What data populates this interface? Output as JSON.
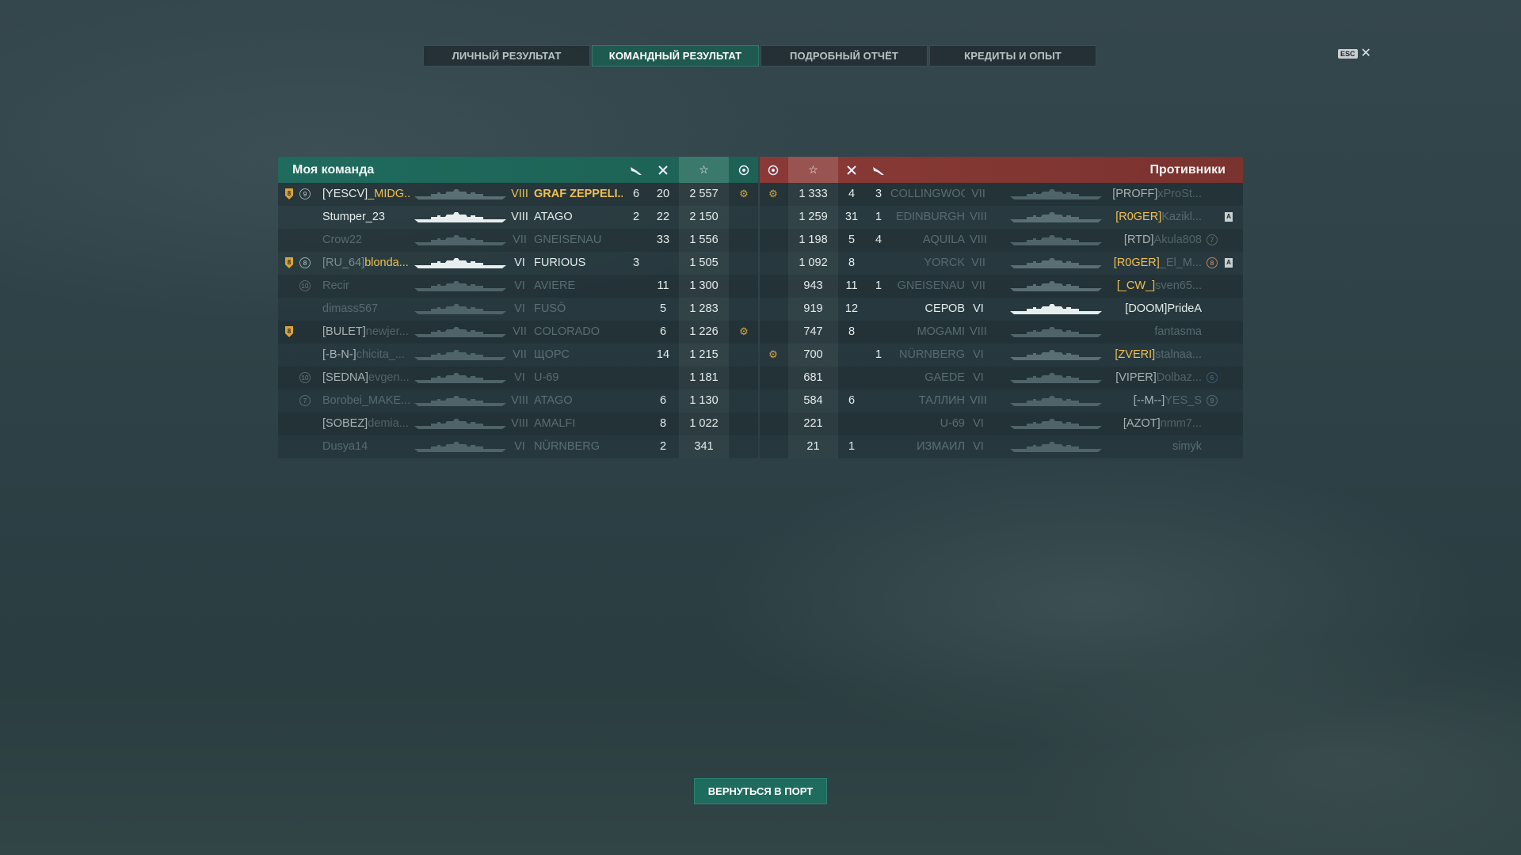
{
  "tabs": [
    "ЛИЧНЫЙ РЕЗУЛЬТАТ",
    "КОМАНДНЫЙ РЕЗУЛЬТАТ",
    "ПОДРОБНЫЙ ОТЧЁТ",
    "КРЕДИТЫ И ОПЫТ"
  ],
  "active_tab": 1,
  "esc": {
    "key": "ESC",
    "close": "✕"
  },
  "my_team": {
    "title": "Моя команда",
    "header_icons": [
      "plane-icon",
      "crossed-swords-icon",
      "star-icon",
      "laurel-icon"
    ],
    "rows": [
      {
        "shield": "8",
        "badge": "9",
        "clan": "[YESCV]",
        "player": "_MIDG...",
        "tier": "VIII",
        "ship": "GRAF ZEPPELI...",
        "planes": "6",
        "kills": "20",
        "xp": "2 557",
        "medal": true,
        "style": "gold",
        "ship_style": "dark"
      },
      {
        "shield": "",
        "badge": "",
        "clan": "",
        "player": "Stumper_23",
        "tier": "VIII",
        "ship": "ATAGO",
        "planes": "2",
        "kills": "22",
        "xp": "2 150",
        "medal": false,
        "style": "normal",
        "ship_style": "light"
      },
      {
        "shield": "",
        "badge": "",
        "clan": "",
        "player": "Crow22",
        "tier": "VII",
        "ship": "GNEISENAU",
        "planes": "",
        "kills": "33",
        "xp": "1 556",
        "medal": false,
        "style": "dim",
        "ship_style": "dark"
      },
      {
        "shield": "8",
        "badge": "8",
        "clan": "[RU_64]",
        "player": "blonda...",
        "tier": "VI",
        "ship": "FURIOUS",
        "planes": "3",
        "kills": "",
        "xp": "1 505",
        "medal": false,
        "style": "gold-name",
        "ship_style": "light"
      },
      {
        "shield": "",
        "badge": "10",
        "clan": "",
        "player": "Recir",
        "tier": "VI",
        "ship": "AVIERE",
        "planes": "",
        "kills": "11",
        "xp": "1 300",
        "medal": false,
        "style": "dim",
        "ship_style": "dark"
      },
      {
        "shield": "",
        "badge": "",
        "clan": "",
        "player": "dimass567",
        "tier": "VI",
        "ship": "FUSŌ",
        "planes": "",
        "kills": "5",
        "xp": "1 283",
        "medal": false,
        "style": "dim",
        "ship_style": "dark"
      },
      {
        "shield": "8",
        "badge": "",
        "clan": "[BULET]",
        "player": "newjer...",
        "tier": "VII",
        "ship": "COLORADO",
        "planes": "",
        "kills": "6",
        "xp": "1 226",
        "medal": true,
        "style": "dim-name",
        "ship_style": "dark"
      },
      {
        "shield": "",
        "badge": "",
        "clan": "[-B-N-]",
        "player": "chicita_...",
        "tier": "VII",
        "ship": "ЩОРС",
        "planes": "",
        "kills": "14",
        "xp": "1 215",
        "medal": false,
        "style": "dim-name",
        "ship_style": "dark"
      },
      {
        "shield": "",
        "badge": "10",
        "clan": "[SEDNA]",
        "player": "evgen...",
        "tier": "VI",
        "ship": "U-69",
        "planes": "",
        "kills": "",
        "xp": "1 181",
        "medal": false,
        "style": "dim-name",
        "ship_style": "dark"
      },
      {
        "shield": "",
        "badge": "7",
        "clan": "",
        "player": "Borobei_MAKE...",
        "tier": "VIII",
        "ship": "ATAGO",
        "planes": "",
        "kills": "6",
        "xp": "1 130",
        "medal": false,
        "style": "dim",
        "ship_style": "dark"
      },
      {
        "shield": "",
        "badge": "",
        "clan": "[SOBEZ]",
        "player": "demia...",
        "tier": "VIII",
        "ship": "AMALFI",
        "planes": "",
        "kills": "8",
        "xp": "1 022",
        "medal": false,
        "style": "dim-name",
        "ship_style": "dark"
      },
      {
        "shield": "",
        "badge": "",
        "clan": "",
        "player": "Dusya14",
        "tier": "VI",
        "ship": "NÜRNBERG",
        "planes": "",
        "kills": "2",
        "xp": "341",
        "medal": false,
        "style": "dim",
        "ship_style": "dark"
      }
    ]
  },
  "enemies": {
    "title": "Противники",
    "header_icons": [
      "laurel-icon",
      "star-icon",
      "crossed-swords-icon",
      "plane-icon"
    ],
    "rows": [
      {
        "medal": true,
        "xp": "1 333",
        "kills": "4",
        "planes": "3",
        "ship": "COLLINGWOOD",
        "tier": "VII",
        "clan": "[PROFF]",
        "player": "xProSt...",
        "badge": "",
        "rank": "",
        "style": "dim-name",
        "ship_style": "dark"
      },
      {
        "medal": false,
        "xp": "1 259",
        "kills": "31",
        "planes": "1",
        "ship": "EDINBURGH",
        "tier": "VIII",
        "clan": "[R0GER]",
        "player": "Kazikl...",
        "badge": "",
        "rank": "A",
        "style": "gold-clan",
        "ship_style": "dark"
      },
      {
        "medal": false,
        "xp": "1 198",
        "kills": "5",
        "planes": "4",
        "ship": "AQUILA",
        "tier": "VIII",
        "clan": "[RTD]",
        "player": "Akula808",
        "badge": "7",
        "rank": "",
        "style": "dim-name",
        "ship_style": "dark"
      },
      {
        "medal": false,
        "xp": "1 092",
        "kills": "8",
        "planes": "",
        "ship": "YORCK",
        "tier": "VII",
        "clan": "[R0GER]",
        "player": "_El_M...",
        "badge": "8",
        "rank": "A",
        "style": "gold-clan",
        "ship_style": "dark"
      },
      {
        "medal": false,
        "xp": "943",
        "kills": "11",
        "planes": "1",
        "ship": "GNEISENAU",
        "tier": "VII",
        "clan": "[_CW_]",
        "player": "sven65...",
        "badge": "",
        "rank": "",
        "style": "gold-clan",
        "ship_style": "dark"
      },
      {
        "medal": false,
        "xp": "919",
        "kills": "12",
        "planes": "",
        "ship": "СЕРОВ",
        "tier": "VI",
        "clan": "[DOOM]",
        "player": "PrideA",
        "badge": "",
        "rank": "",
        "style": "normal",
        "ship_style": "light"
      },
      {
        "medal": false,
        "xp": "747",
        "kills": "8",
        "planes": "",
        "ship": "MOGAMI",
        "tier": "VIII",
        "clan": "",
        "player": "fantasma",
        "badge": "",
        "rank": "",
        "style": "dim",
        "ship_style": "dark"
      },
      {
        "medal": true,
        "xp": "700",
        "kills": "",
        "planes": "1",
        "ship": "NÜRNBERG",
        "tier": "VI",
        "clan": "[ZVERI]",
        "player": "stalnaa...",
        "badge": "",
        "rank": "",
        "style": "gold-clan",
        "ship_style": "dark"
      },
      {
        "medal": false,
        "xp": "681",
        "kills": "",
        "planes": "",
        "ship": "GAEDE",
        "tier": "VI",
        "clan": "[VIPER]",
        "player": "Dolbaz...",
        "badge": "6",
        "rank": "",
        "style": "dim-name",
        "ship_style": "dark"
      },
      {
        "medal": false,
        "xp": "584",
        "kills": "6",
        "planes": "",
        "ship": "ТАЛЛИН",
        "tier": "VIII",
        "clan": "[--M--]",
        "player": "YES_S",
        "badge": "9",
        "rank": "",
        "style": "dim-name",
        "ship_style": "dark"
      },
      {
        "medal": false,
        "xp": "221",
        "kills": "",
        "planes": "",
        "ship": "U-69",
        "tier": "VI",
        "clan": "[AZOT]",
        "player": "nmm7...",
        "badge": "",
        "rank": "",
        "style": "dim-name",
        "ship_style": "dark"
      },
      {
        "medal": false,
        "xp": "21",
        "kills": "1",
        "planes": "",
        "ship": "ИЗМАИЛ",
        "tier": "VI",
        "clan": "",
        "player": "simyk",
        "badge": "",
        "rank": "",
        "style": "dim",
        "ship_style": "dark"
      }
    ]
  },
  "return_button": "ВЕРНУТЬСЯ В ПОРТ",
  "colors": {
    "accent": "#1f6b5e",
    "enemy": "#8a3a36",
    "gold": "#f0c050"
  }
}
